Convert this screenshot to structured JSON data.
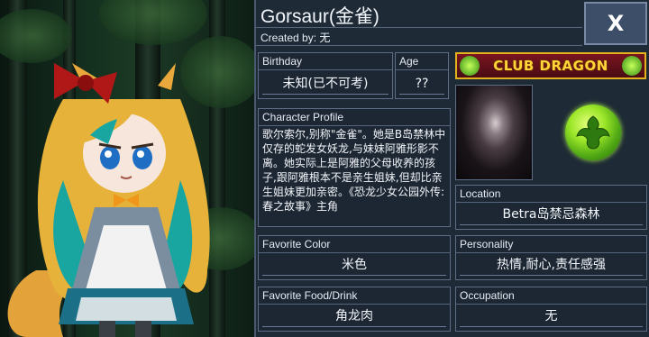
{
  "character": {
    "name": "Gorsaur(金雀)",
    "created_by_label": "Created by:",
    "created_by_value": "无"
  },
  "close_label": "X",
  "fields": {
    "birthday": {
      "label": "Birthday",
      "value": "未知(已不可考)"
    },
    "age": {
      "label": "Age",
      "value": "??"
    },
    "profile": {
      "label": "Character Profile",
      "value": "歌尔索尔,别称\"金雀\"。她是B岛禁林中仅存的蛇发女妖龙,与妹妹阿雅形影不离。她实际上是阿雅的父母收养的孩子,跟阿雅根本不是亲生姐妹,但却比亲生姐妹更加亲密。《恐龙少女公园外传:春之故事》主角"
    },
    "location": {
      "label": "Location",
      "value": "Betra岛禁忌森林"
    },
    "favorite_color": {
      "label": "Favorite Color",
      "value": "米色"
    },
    "personality": {
      "label": "Personality",
      "value": "热情,耐心,责任感强"
    },
    "favorite_food": {
      "label": "Favorite Food/Drink",
      "value": "角龙肉"
    },
    "occupation": {
      "label": "Occupation",
      "value": "无"
    }
  },
  "club_banner": "CLUB DRAGON",
  "icons": {
    "close": "close-icon",
    "emblem": "dragon-emblem-icon",
    "banner": "club-dragon-logo"
  },
  "colors": {
    "panel_bg": "#1e2a36",
    "box_border": "#5d6d85",
    "text": "#f2f5fa",
    "banner_gold": "#ffd53a",
    "emblem_green": "#9be629"
  }
}
